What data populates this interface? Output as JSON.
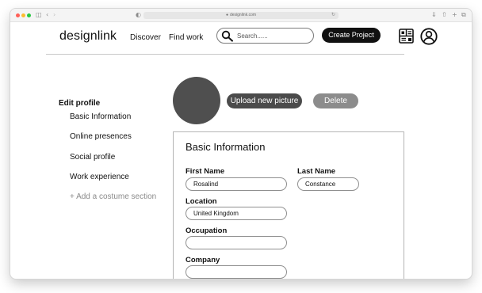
{
  "browser": {
    "url": "designlink.com",
    "icons": [
      "sidebar-icon",
      "back-icon",
      "forward-icon",
      "shield-icon",
      "reload-icon",
      "download-icon",
      "share-icon",
      "new-tab-icon",
      "tabs-icon"
    ]
  },
  "header": {
    "logo": "designlink",
    "nav": [
      "Discover",
      "Find work"
    ],
    "search_placeholder": "Search......",
    "create_label": "Create Project"
  },
  "sidebar": {
    "title": "Edit profile",
    "items": [
      "Basic Information",
      "Online presences",
      "Social profile",
      "Work experience"
    ],
    "add_label": "+ Add a costume section"
  },
  "profile": {
    "upload_label": "Upload new picture",
    "delete_label": "Delete"
  },
  "form": {
    "title": "Basic Information",
    "first_name_label": "First Name",
    "first_name_value": "Rosalind",
    "last_name_label": "Last Name",
    "last_name_value": "Constance",
    "location_label": "Location",
    "location_value": "United Kingdom",
    "occupation_label": "Occupation",
    "occupation_value": "",
    "company_label": "Company",
    "company_value": ""
  }
}
